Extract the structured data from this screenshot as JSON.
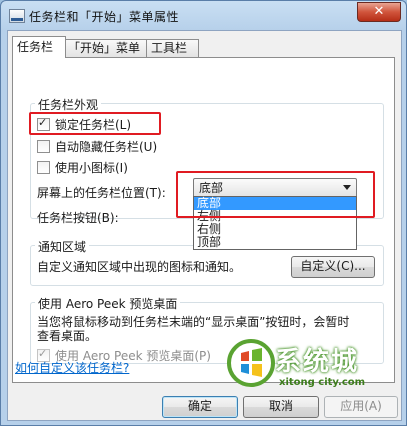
{
  "window": {
    "title": "任务栏和「开始」菜单属性",
    "close_glyph": "✕"
  },
  "tabs": [
    {
      "label": "任务栏",
      "active": true
    },
    {
      "label": "「开始」菜单",
      "active": false
    },
    {
      "label": "工具栏",
      "active": false
    }
  ],
  "appearance": {
    "label": "任务栏外观",
    "lock_taskbar": {
      "label": "锁定任务栏(L)",
      "checked": true
    },
    "auto_hide": {
      "label": "自动隐藏任务栏(U)",
      "checked": false
    },
    "small_icons": {
      "label": "使用小图标(I)",
      "checked": false
    },
    "location_label": "屏幕上的任务栏位置(T):",
    "location_value": "底部",
    "location_options": [
      "底部",
      "左侧",
      "右侧",
      "顶部"
    ],
    "buttons_label": "任务栏按钮(B):"
  },
  "notification": {
    "label": "通知区域",
    "text": "自定义通知区域中出现的图标和通知。",
    "customize_button": "自定义(C)..."
  },
  "aero_peek": {
    "label": "使用 Aero Peek 预览桌面",
    "description_line1": "当您将鼠标移动到任务栏末端的“显示桌面”按钮时，会暂时",
    "description_line2": "查看桌面。",
    "checkbox_label": "使用 Aero Peek 预览桌面(P)",
    "checked": true
  },
  "help_link": "如何自定义该任务栏?",
  "buttons": {
    "ok": "确定",
    "cancel": "取消",
    "apply": "应用(A)"
  },
  "watermark": {
    "brand": "系统城",
    "url": "xitong city.com"
  },
  "colors": {
    "highlight": "#e01b22",
    "selection": "#3399ff",
    "link": "#0066cc"
  }
}
